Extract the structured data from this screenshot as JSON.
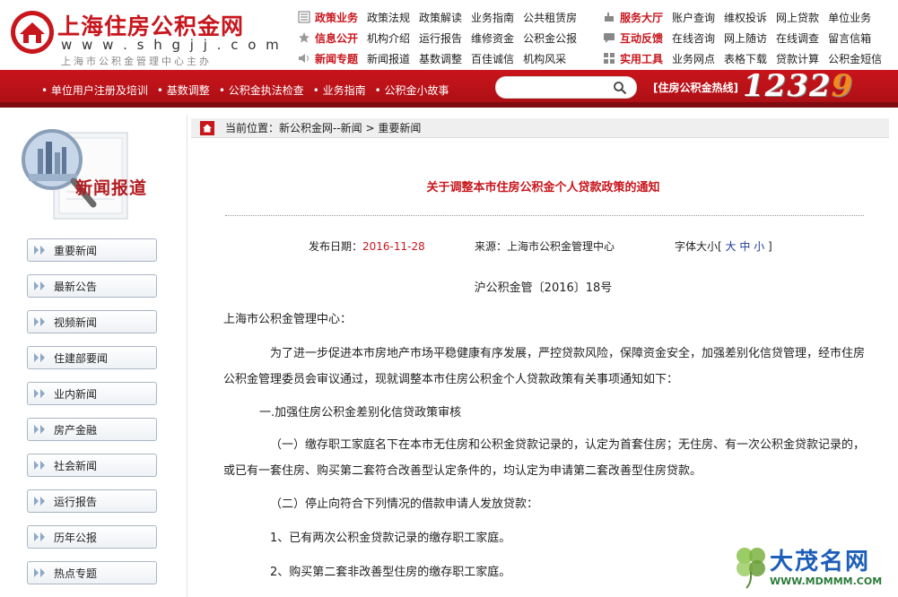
{
  "site": {
    "title": "上海住房公积金网",
    "url": "w w w . s h g j j . c o m",
    "subtitle": "上海市公积金管理中心主办"
  },
  "nav": {
    "rows": [
      {
        "groups": [
          {
            "cat": "政策业务",
            "links": [
              "政策法规",
              "政策解读",
              "业务指南",
              "公共租赁房"
            ]
          },
          {
            "cat": "服务大厅",
            "links": [
              "账户查询",
              "维权投诉",
              "网上贷款",
              "单位业务"
            ]
          }
        ]
      },
      {
        "groups": [
          {
            "cat": "信息公开",
            "links": [
              "机构介绍",
              "运行报告",
              "维修资金",
              "公积金公报"
            ]
          },
          {
            "cat": "互动反馈",
            "links": [
              "在线咨询",
              "网上随访",
              "在线调查",
              "留言信箱"
            ]
          }
        ]
      },
      {
        "groups": [
          {
            "cat": "新闻专题",
            "links": [
              "新闻报道",
              "基数调整",
              "百佳诚信",
              "机构风采"
            ]
          },
          {
            "cat": "实用工具",
            "links": [
              "业务网点",
              "表格下载",
              "贷款计算",
              "公积金短信"
            ]
          }
        ]
      }
    ]
  },
  "quicklinks": [
    "• 单位用户注册及培训",
    "• 基数调整",
    "• 公积金执法检查",
    "• 业务指南",
    "• 公积金小故事"
  ],
  "search": {
    "placeholder": ""
  },
  "hotline": {
    "label": "[住房公积金热线]",
    "number_a": "1232",
    "number_b": "9"
  },
  "sidebar": {
    "section_title": "新闻报道",
    "items": [
      "重要新闻",
      "最新公告",
      "视频新闻",
      "住建部要闻",
      "业内新闻",
      "房产金融",
      "社会新闻",
      "运行报告",
      "历年公报",
      "热点专题"
    ]
  },
  "breadcrumb": "当前位置：新公积金网--新闻 > 重要新闻",
  "article": {
    "title": "关于调整本市住房公积金个人贷款政策的通知",
    "date_label": "发布日期：",
    "date": "2016-11-28",
    "source_label": "来源：",
    "source": "上海市公积金管理中心",
    "font_label": "字体大小[",
    "font_sizes": [
      "大",
      "中",
      "小"
    ],
    "font_end": "]",
    "doc_no": "沪公积金管〔2016〕18号",
    "salutation": "上海市公积金管理中心：",
    "p1": "为了进一步促进本市房地产市场平稳健康有序发展，严控贷款风险，保障资金安全，加强差别化信贷管理，经市住房公积金管理委员会审议通过，现就调整本市住房公积金个人贷款政策有关事项通知如下：",
    "h1": "一.加强住房公积金差别化信贷政策审核",
    "p2": "（一）缴存职工家庭名下在本市无住房和公积金贷款记录的，认定为首套住房；无住房、有一次公积金贷款记录的，或已有一套住房、购买第二套符合改善型认定条件的，均认定为申请第二套改善型住房贷款。",
    "p3": "（二）停止向符合下列情况的借款申请人发放贷款：",
    "p4": "1、已有两次公积金贷款记录的缴存职工家庭。",
    "p5": "2、购买第二套非改善型住房的缴存职工家庭。"
  },
  "watermark": {
    "text": "大茂名网",
    "url": "WWW.MDMMM.COM"
  },
  "colors": {
    "brand_red": "#c8161d",
    "bar_red": "#b3121a",
    "hotline_orange": "#f08a1e"
  }
}
